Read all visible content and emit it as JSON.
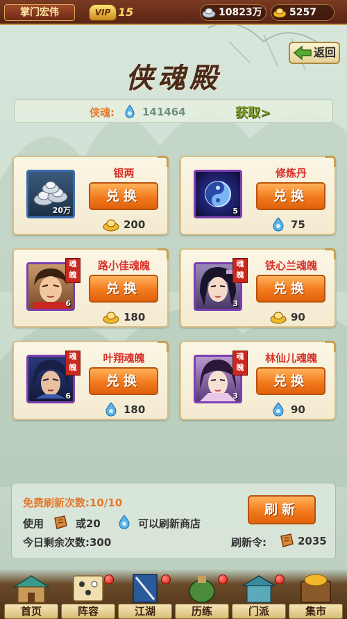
{
  "header": {
    "player_name": "掌门宏伟",
    "vip_label": "VIP",
    "vip_level": "15",
    "silver": "10823万",
    "gold": "5257"
  },
  "nav": {
    "back_label": "返回"
  },
  "title": "侠魂殿",
  "soul": {
    "label": "侠魂:",
    "value": "141464",
    "get_label": "获取>"
  },
  "items": [
    {
      "name": "银两",
      "count": "20万",
      "button": "兑换",
      "price": "200",
      "currency": "gold-ingot-icon",
      "portrait": false
    },
    {
      "name": "修炼丹",
      "count": "5",
      "button": "兑换",
      "price": "75",
      "currency": "soul-flame-icon",
      "portrait": false
    },
    {
      "name": "路小佳魂魄",
      "count": "6",
      "button": "兑换",
      "price": "180",
      "currency": "gold-ingot-icon",
      "tag": "魂魄",
      "portrait": true
    },
    {
      "name": "铁心兰魂魄",
      "count": "3",
      "button": "兑换",
      "price": "90",
      "currency": "gold-ingot-icon",
      "tag": "魂魄",
      "portrait": true
    },
    {
      "name": "叶翔魂魄",
      "count": "6",
      "button": "兑换",
      "price": "180",
      "currency": "soul-flame-icon",
      "tag": "魂魄",
      "portrait": true
    },
    {
      "name": "林仙儿魂魄",
      "count": "3",
      "button": "兑换",
      "price": "90",
      "currency": "soul-flame-icon",
      "tag": "魂魄",
      "portrait": true
    }
  ],
  "refresh": {
    "free_text": "免费刷新次数:10/10",
    "use_prefix": "使用",
    "use_or": "或20",
    "use_suffix": "可以刷新商店",
    "remaining_text": "今日剩余次数:300",
    "button_label": "刷新",
    "token_label": "刷新令:",
    "token_value": "2035"
  },
  "bottom_nav": [
    {
      "label": "首页",
      "icon": "home-icon",
      "dot": false
    },
    {
      "label": "阵容",
      "icon": "formation-icon",
      "dot": true
    },
    {
      "label": "江湖",
      "icon": "jianghu-icon",
      "dot": true
    },
    {
      "label": "历练",
      "icon": "training-icon",
      "dot": true
    },
    {
      "label": "门派",
      "icon": "sect-icon",
      "dot": true
    },
    {
      "label": "集市",
      "icon": "market-icon",
      "dot": false
    }
  ],
  "colors": {
    "accent_orange": "#f27a1e",
    "name_red": "#d8302a",
    "label_orange": "#e8762a"
  }
}
